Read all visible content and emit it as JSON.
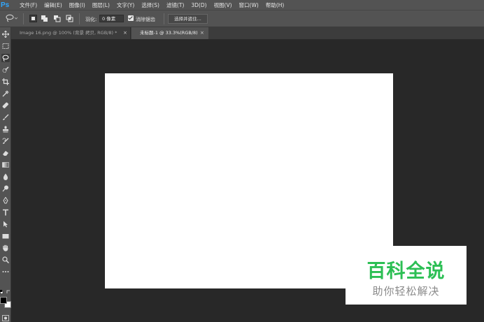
{
  "app": {
    "logo": "Ps"
  },
  "menu": [
    "文件(F)",
    "编辑(E)",
    "图像(I)",
    "图层(L)",
    "文字(Y)",
    "选择(S)",
    "滤镜(T)",
    "3D(D)",
    "视图(V)",
    "窗口(W)",
    "帮助(H)"
  ],
  "options": {
    "tool_icon": "lasso-icon",
    "feather_label": "羽化:",
    "feather_value": "0 像素",
    "antialias_label": "消除锯齿",
    "antialias_checked": true,
    "select_mask_label": "选择并遮住..."
  },
  "tabs": [
    {
      "label": "Image 16.png @ 100% (背景 拷贝, RGB/8) *",
      "active": false,
      "close": "×"
    },
    {
      "label": "未标题-1 @ 33.3%(RGB/8)",
      "active": true,
      "close": "×"
    }
  ],
  "tools": [
    "move-icon",
    "marquee-icon",
    "lasso-icon",
    "quick-select-icon",
    "crop-icon",
    "eyedropper-icon",
    "healing-icon",
    "brush-icon",
    "stamp-icon",
    "history-brush-icon",
    "eraser-icon",
    "gradient-icon",
    "blur-icon",
    "dodge-icon",
    "pen-icon",
    "type-icon",
    "path-select-icon",
    "rectangle-icon",
    "hand-icon",
    "zoom-icon",
    "more-icon"
  ],
  "colors": {
    "foreground": "#000000",
    "background": "#ffffff",
    "accent": "#31a8ff",
    "watermark": "#2cbf54"
  },
  "watermark": {
    "title": "百科全说",
    "subtitle": "助你轻松解决"
  }
}
